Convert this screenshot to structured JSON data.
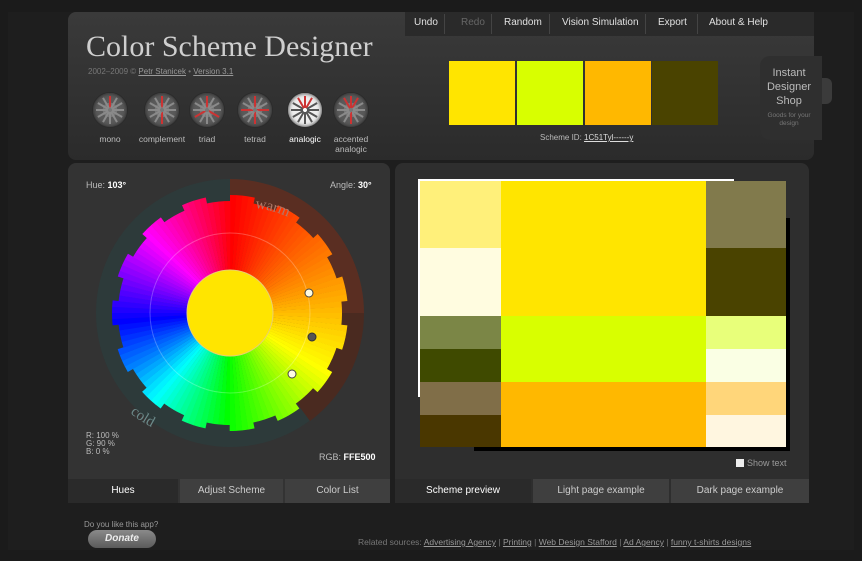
{
  "app": {
    "title": "Color Scheme Designer",
    "copyright_prefix": "2002–2009 ©",
    "author": "Petr Stanicek",
    "version": "Version 3.1"
  },
  "menu": [
    {
      "label": "Undo",
      "enabled": true
    },
    {
      "label": "Redo",
      "enabled": false
    },
    {
      "label": "Random",
      "enabled": true
    },
    {
      "label": "Vision Simulation",
      "enabled": true
    },
    {
      "label": "Export",
      "enabled": true
    },
    {
      "label": "About & Help",
      "enabled": true
    }
  ],
  "scheme_types": [
    {
      "label": "mono",
      "active": false
    },
    {
      "label": "complement",
      "active": false
    },
    {
      "label": "triad",
      "active": false
    },
    {
      "label": "tetrad",
      "active": false
    },
    {
      "label": "analogic",
      "active": true
    },
    {
      "label": "accented\nanalogic",
      "active": false
    }
  ],
  "swatches": [
    "#FFE500",
    "#D8FF00",
    "#FFB800",
    "#4A4300"
  ],
  "scheme_id": {
    "label": "Scheme ID:",
    "value": "1C51Tyl------y"
  },
  "shop": {
    "title": "Instant Designer Shop",
    "subtitle": "Goods for your design"
  },
  "wheel": {
    "hue_label": "Hue:",
    "hue_value": "103°",
    "angle_label": "Angle:",
    "angle_value": "30°",
    "warm": "warm",
    "cold": "cold",
    "rgb_label": "RGB:",
    "rgb_value": "FFE500",
    "r": "R: 100 %",
    "g": "G:  90 %",
    "b": "B:   0 %",
    "center_color": "#FFE500"
  },
  "left_tabs": [
    {
      "label": "Hues",
      "active": true
    },
    {
      "label": "Adjust Scheme",
      "active": false
    },
    {
      "label": "Color List",
      "active": false
    }
  ],
  "right_tabs": [
    {
      "label": "Scheme preview",
      "active": true
    },
    {
      "label": "Light page example",
      "active": false
    },
    {
      "label": "Dark page example",
      "active": false
    }
  ],
  "show_text": "Show text",
  "footer": {
    "do_you_like": "Do you like this app?",
    "donate": "Donate",
    "related_prefix": "Related sources:",
    "links": [
      "Advertising Agency",
      "Printing",
      "Web Design Stafford",
      "Ad Agency",
      "funny t-shirts designs"
    ]
  }
}
